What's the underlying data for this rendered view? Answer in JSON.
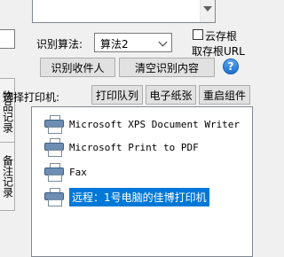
{
  "left": {
    "tab_records": "物品记录",
    "tab_notes": "备注记录"
  },
  "recog": {
    "algo_label": "识别算法:",
    "algo_value": "算法2",
    "cloud_save_label": "云存根",
    "get_url_label": "取存根URL",
    "help_glyph": "?",
    "recognize_button": "识别收件人",
    "clear_button": "清空识别内容"
  },
  "printer": {
    "select_label": "选择打印机:",
    "queue_button": "打印队列",
    "paper_button": "电子纸张",
    "restart_button": "重启组件",
    "items": [
      {
        "name": "Microsoft XPS Document Writer",
        "selected": false
      },
      {
        "name": "Microsoft Print to PDF",
        "selected": false
      },
      {
        "name": "Fax",
        "selected": false
      },
      {
        "name": "远程：1号电脑的佳博打印机",
        "selected": true
      }
    ]
  },
  "colors": {
    "selection": "#0078d7",
    "window_bg": "#f0f0f0"
  }
}
